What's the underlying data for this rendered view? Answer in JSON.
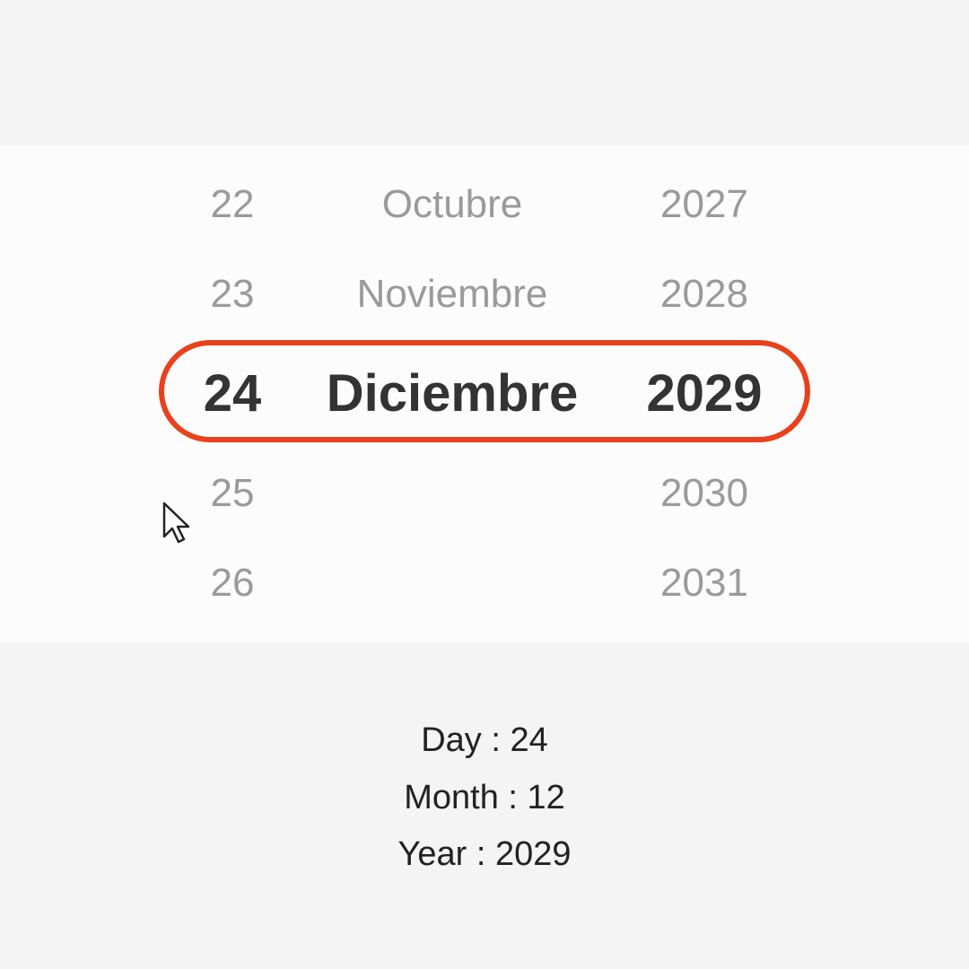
{
  "picker": {
    "day": {
      "above": [
        "22",
        "23"
      ],
      "selected": "24",
      "below": [
        "25",
        "26"
      ]
    },
    "month": {
      "above": [
        "Octubre",
        "Noviembre"
      ],
      "selected": "Diciembre"
    },
    "year": {
      "above": [
        "2027",
        "2028"
      ],
      "selected": "2029",
      "below": [
        "2030",
        "2031"
      ]
    },
    "highlight_color": "#e8411c"
  },
  "result": {
    "day_text": "Day : 24",
    "month_text": "Month : 12",
    "year_text": "Year : 2029"
  },
  "cursor": {
    "icon": "mouse-pointer-icon"
  }
}
